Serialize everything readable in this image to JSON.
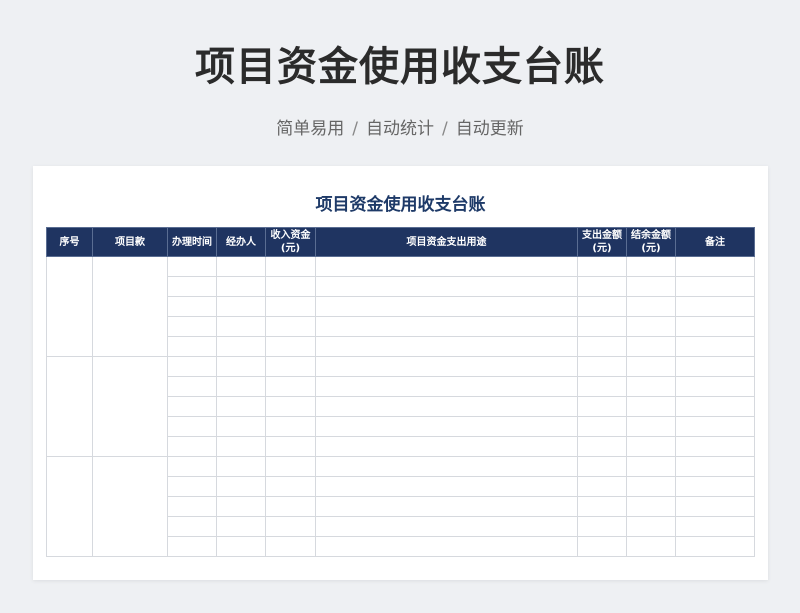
{
  "header": {
    "title": "项目资金使用收支台账",
    "tags": [
      "简单易用",
      "自动统计",
      "自动更新"
    ],
    "separator": "/"
  },
  "sheet": {
    "title": "项目资金使用收支台账",
    "columns": [
      {
        "key": "seq",
        "label": "序号"
      },
      {
        "key": "project",
        "label": "项目款"
      },
      {
        "key": "time",
        "label": "办理时间"
      },
      {
        "key": "handler",
        "label": "经办人"
      },
      {
        "key": "income",
        "label": "收入资金\n(元)"
      },
      {
        "key": "purpose",
        "label": "项目资金支出用途"
      },
      {
        "key": "expense",
        "label": "支出金额\n(元)"
      },
      {
        "key": "balance",
        "label": "结余金额\n(元)"
      },
      {
        "key": "notes",
        "label": "备注"
      }
    ],
    "groups": 3,
    "rows_per_group": 5,
    "header_bg": "#1f3461",
    "title_color": "#1e3a68"
  }
}
